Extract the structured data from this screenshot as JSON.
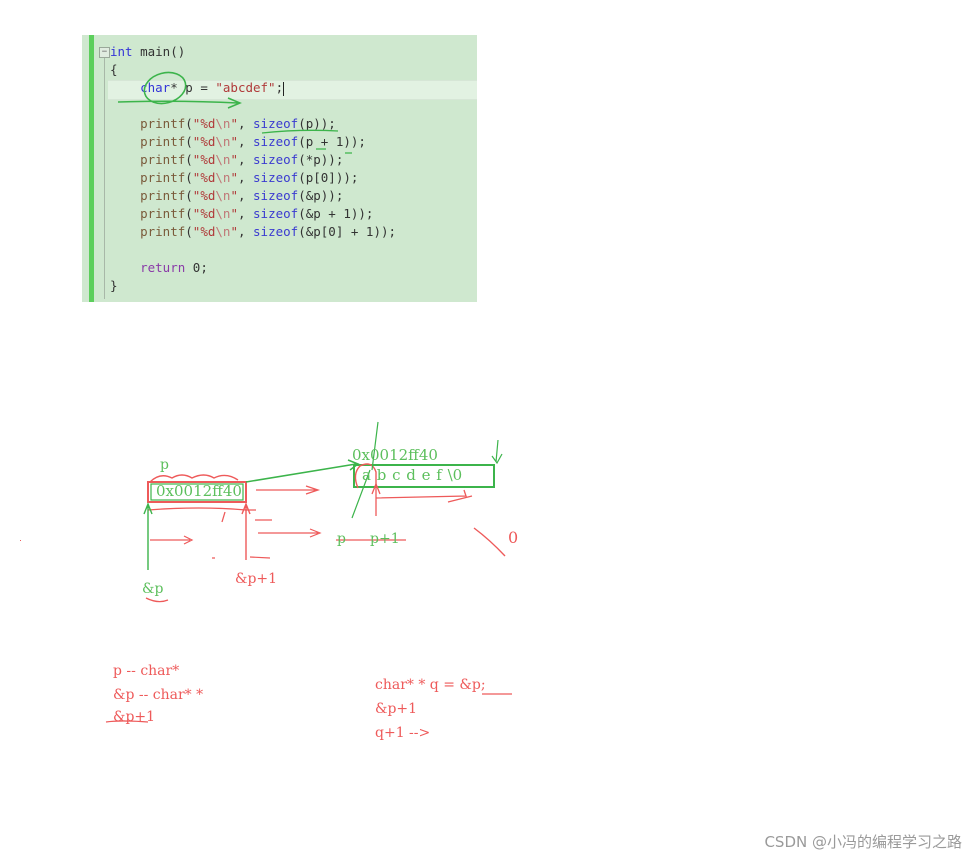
{
  "code_panel": {
    "fold_icon": "minus",
    "lines": [
      {
        "parts": [
          [
            "kw",
            "int"
          ],
          [
            "plain",
            " main()"
          ]
        ]
      },
      {
        "parts": [
          [
            "plain",
            "{"
          ]
        ]
      },
      {
        "parts": [
          [
            "plain",
            "    "
          ],
          [
            "kw",
            "char"
          ],
          [
            "plain",
            "* p = "
          ],
          [
            "str",
            "\"abcdef\""
          ],
          [
            "plain",
            ";"
          ]
        ]
      },
      {
        "parts": []
      },
      {
        "parts": [
          [
            "plain",
            "    "
          ],
          [
            "fn",
            "printf"
          ],
          [
            "plain",
            "("
          ],
          [
            "str",
            "\"%d"
          ],
          [
            "esc",
            "\\n"
          ],
          [
            "str",
            "\""
          ],
          [
            "plain",
            ", "
          ],
          [
            "fnb",
            "sizeof"
          ],
          [
            "plain",
            "(p));"
          ]
        ]
      },
      {
        "parts": [
          [
            "plain",
            "    "
          ],
          [
            "fn",
            "printf"
          ],
          [
            "plain",
            "("
          ],
          [
            "str",
            "\"%d"
          ],
          [
            "esc",
            "\\n"
          ],
          [
            "str",
            "\""
          ],
          [
            "plain",
            ", "
          ],
          [
            "fnb",
            "sizeof"
          ],
          [
            "plain",
            "(p + 1));"
          ]
        ]
      },
      {
        "parts": [
          [
            "plain",
            "    "
          ],
          [
            "fn",
            "printf"
          ],
          [
            "plain",
            "("
          ],
          [
            "str",
            "\"%d"
          ],
          [
            "esc",
            "\\n"
          ],
          [
            "str",
            "\""
          ],
          [
            "plain",
            ", "
          ],
          [
            "fnb",
            "sizeof"
          ],
          [
            "plain",
            "(*p));"
          ]
        ]
      },
      {
        "parts": [
          [
            "plain",
            "    "
          ],
          [
            "fn",
            "printf"
          ],
          [
            "plain",
            "("
          ],
          [
            "str",
            "\"%d"
          ],
          [
            "esc",
            "\\n"
          ],
          [
            "str",
            "\""
          ],
          [
            "plain",
            ", "
          ],
          [
            "fnb",
            "sizeof"
          ],
          [
            "plain",
            "(p[0]));"
          ]
        ]
      },
      {
        "parts": [
          [
            "plain",
            "    "
          ],
          [
            "fn",
            "printf"
          ],
          [
            "plain",
            "("
          ],
          [
            "str",
            "\"%d"
          ],
          [
            "esc",
            "\\n"
          ],
          [
            "str",
            "\""
          ],
          [
            "plain",
            ", "
          ],
          [
            "fnb",
            "sizeof"
          ],
          [
            "plain",
            "(&p));"
          ]
        ]
      },
      {
        "parts": [
          [
            "plain",
            "    "
          ],
          [
            "fn",
            "printf"
          ],
          [
            "plain",
            "("
          ],
          [
            "str",
            "\"%d"
          ],
          [
            "esc",
            "\\n"
          ],
          [
            "str",
            "\""
          ],
          [
            "plain",
            ", "
          ],
          [
            "fnb",
            "sizeof"
          ],
          [
            "plain",
            "(&p + 1));"
          ]
        ]
      },
      {
        "parts": [
          [
            "plain",
            "    "
          ],
          [
            "fn",
            "printf"
          ],
          [
            "plain",
            "("
          ],
          [
            "str",
            "\"%d"
          ],
          [
            "esc",
            "\\n"
          ],
          [
            "str",
            "\""
          ],
          [
            "plain",
            ", "
          ],
          [
            "fnb",
            "sizeof"
          ],
          [
            "plain",
            "(&p[0] + 1));"
          ]
        ]
      },
      {
        "parts": []
      },
      {
        "parts": [
          [
            "plain",
            "    "
          ],
          [
            "kw2",
            "return"
          ],
          [
            "plain",
            " 0;"
          ]
        ]
      },
      {
        "parts": [
          [
            "plain",
            "}"
          ]
        ]
      }
    ]
  },
  "diagram": {
    "p_label": "p",
    "p_box_value": "0x0012ff40",
    "string_address": "0x0012ff40",
    "string_chars": "a b c d e f \\0",
    "amp_p_label": "&p",
    "amp_p_plus1_label": "&p+1",
    "p_arrow_label": "p",
    "p_plus1_label": "p+1",
    "zero_mark": "0"
  },
  "notes_left": [
    "p -- char*",
    "&p -- char* *",
    "&p+1"
  ],
  "notes_right": [
    "char* * q = &p;",
    "&p+1",
    "q+1 -->"
  ],
  "watermark": "CSDN @小冯的编程学习之路",
  "colors": {
    "red_ink": "#ee5a5a",
    "green_ink": "#3cb44b",
    "code_bg": "#cfe8cf"
  }
}
